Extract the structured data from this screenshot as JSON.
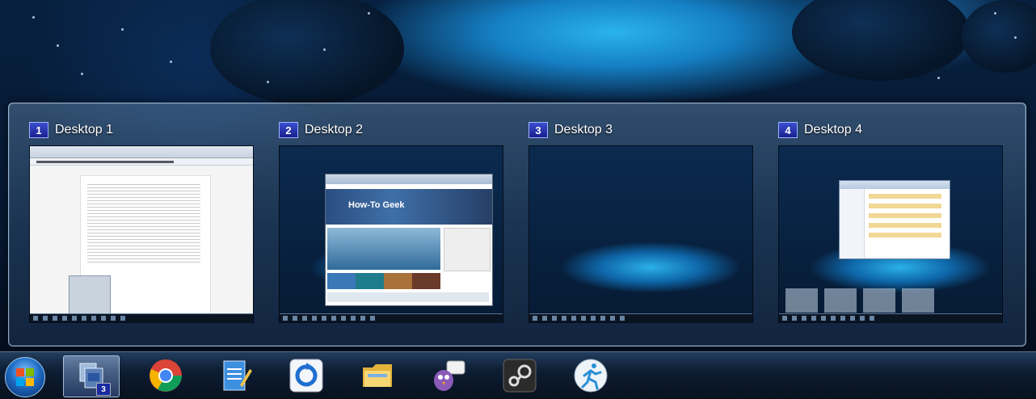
{
  "switcher": {
    "desktops": [
      {
        "number": "1",
        "label": "Desktop 1"
      },
      {
        "number": "2",
        "label": "Desktop 2"
      },
      {
        "number": "3",
        "label": "Desktop 3"
      },
      {
        "number": "4",
        "label": "Desktop 4"
      }
    ],
    "thumbnails": {
      "desktop2_site_banner": "How-To Geek"
    }
  },
  "taskbar": {
    "pinned_icons": [
      "start-orb-icon",
      "desktops-switcher-icon",
      "chrome-icon",
      "notepad-icon",
      "sync-icon",
      "file-explorer-icon",
      "chat-client-icon",
      "steam-icon",
      "runner-icon"
    ],
    "active_badge": "3"
  },
  "colors": {
    "desktop_number_badge": "#1a1f8f",
    "panel_border": "#bed7f0",
    "taskbar": "#08121f"
  }
}
